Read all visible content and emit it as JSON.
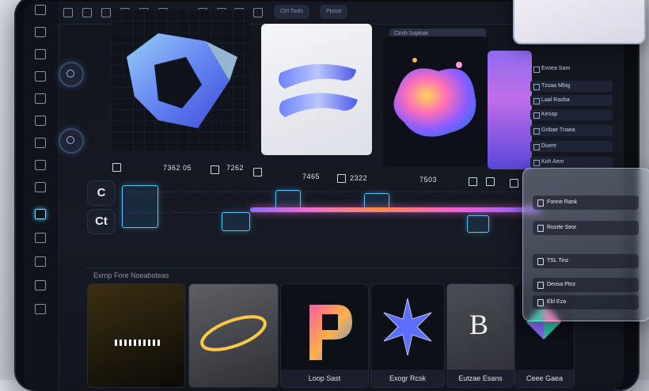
{
  "topbar": {
    "pill_a": "Ctrl Tools",
    "pill_b": "Ppsse",
    "search_label": "Ctrsh Soptoar"
  },
  "right_panel": {
    "header": "Evoea Sam",
    "rows": [
      "Tzsaa Mbig",
      "Laal Raoba",
      "Keoap",
      "Gnbae Tnaea",
      "Duere",
      "Koh Aem"
    ]
  },
  "timeline": {
    "row1": {
      "a": "7362 05",
      "b": "7262",
      "c": "7465",
      "d": "2322",
      "e": "7503"
    },
    "tool_btn_1": "C",
    "tool_btn_2": "Ct"
  },
  "bottom_panel": {
    "title": "Exrnp Fore Noeaboteas",
    "cards": [
      "",
      "",
      "Loop Sast",
      "Exogr Rcsk",
      "Eutzae Esans",
      "Ceee Gaea"
    ]
  },
  "glass_panel": {
    "rows": [
      "Fonne Rank",
      "Rosrte Seor",
      "TSL Tinz",
      "Deosa Ptnz",
      "Ebl Eza"
    ]
  },
  "colors": {
    "accent_cyan": "#4ec6ff",
    "accent_pink": "#f85fd0",
    "accent_orange": "#ff8a4a"
  }
}
